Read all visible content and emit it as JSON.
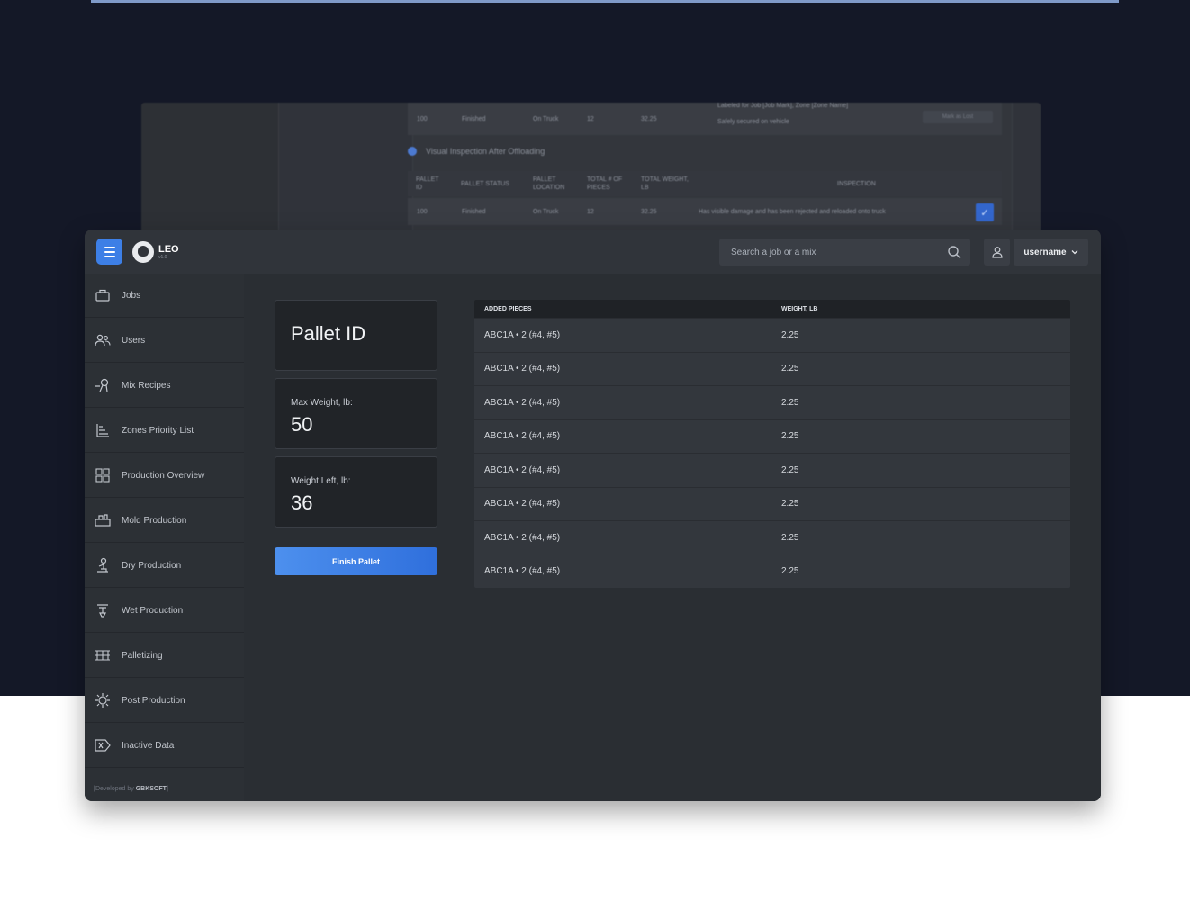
{
  "background_window": {
    "row1": [
      "100",
      "Finished",
      "On Truck",
      "12",
      "32.25"
    ],
    "row1_inspection_a": "Labeled for Job [Job Mark], Zone [Zone Name]",
    "row1_inspection_b": "Safely secured on vehicle",
    "row1_button": "Mark as Lost",
    "section_title": "Visual Inspection After Offloading",
    "headers": [
      "PALLET ID",
      "PALLET STATUS",
      "PALLET LOCATION",
      "TOTAL # OF PIECES",
      "TOTAL WEIGHT, LB",
      "INSPECTION"
    ],
    "row2": [
      "100",
      "Finished",
      "On Truck",
      "12",
      "32.25"
    ],
    "row2_inspection": "Has visible damage and has been rejected and reloaded onto truck"
  },
  "header": {
    "app_name": "LEO",
    "app_version": "v1.0",
    "search_placeholder": "Search a job or a mix",
    "username": "username"
  },
  "sidebar": {
    "items": [
      {
        "label": "Jobs",
        "icon": "briefcase-icon"
      },
      {
        "label": "Users",
        "icon": "users-icon"
      },
      {
        "label": "Mix Recipes",
        "icon": "mixer-icon"
      },
      {
        "label": "Zones Priority List",
        "icon": "priority-list-icon"
      },
      {
        "label": "Production Overview",
        "icon": "overview-grid-icon"
      },
      {
        "label": "Mold Production",
        "icon": "mold-icon"
      },
      {
        "label": "Dry Production",
        "icon": "dry-production-icon"
      },
      {
        "label": "Wet Production",
        "icon": "wet-production-icon"
      },
      {
        "label": "Palletizing",
        "icon": "pallet-icon"
      },
      {
        "label": "Post Production",
        "icon": "gear-box-icon"
      },
      {
        "label": "Inactive Data",
        "icon": "inactive-data-icon"
      }
    ],
    "credit_prefix": "[Developed by ",
    "credit_brand": "GBKSOFT",
    "credit_suffix": "]"
  },
  "pallet": {
    "title": "Pallet ID",
    "max_weight_label": "Max Weight, lb:",
    "max_weight_value": "50",
    "weight_left_label": "Weight Left, lb:",
    "weight_left_value": "36",
    "finish_button": "Finish Pallet"
  },
  "table": {
    "headers": [
      "ADDED PIECES",
      "WEIGHT, LB"
    ],
    "rows": [
      [
        "ABC1A • 2 (#4, #5)",
        "2.25"
      ],
      [
        "ABC1A • 2 (#4, #5)",
        "2.25"
      ],
      [
        "ABC1A • 2 (#4, #5)",
        "2.25"
      ],
      [
        "ABC1A • 2 (#4, #5)",
        "2.25"
      ],
      [
        "ABC1A • 2 (#4, #5)",
        "2.25"
      ],
      [
        "ABC1A • 2 (#4, #5)",
        "2.25"
      ],
      [
        "ABC1A • 2 (#4, #5)",
        "2.25"
      ],
      [
        "ABC1A • 2 (#4, #5)",
        "2.25"
      ]
    ]
  },
  "colors": {
    "accent": "#3d7fe6",
    "page_dark": "#141827",
    "window_bg": "#2a2e33"
  }
}
